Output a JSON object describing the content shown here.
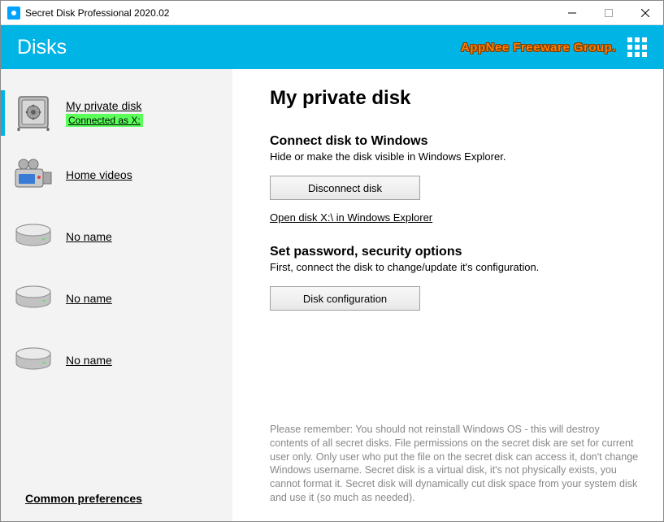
{
  "window": {
    "title": "Secret Disk Professional 2020.02"
  },
  "header": {
    "title": "Disks",
    "brand": "AppNee Freeware Group."
  },
  "sidebar": {
    "items": [
      {
        "label": "My private disk",
        "status": "Connected as X:"
      },
      {
        "label": "Home videos"
      },
      {
        "label": "No name"
      },
      {
        "label": "No name"
      },
      {
        "label": "No name"
      }
    ],
    "common_prefs": "Common preferences"
  },
  "main": {
    "title": "My private disk",
    "connect": {
      "heading": "Connect disk to Windows",
      "desc": "Hide or make the disk visible in Windows Explorer.",
      "button": "Disconnect disk",
      "link": "Open disk X:\\ in Windows Explorer"
    },
    "security": {
      "heading": "Set password, security options",
      "desc": "First, connect the disk to change/update it's configuration.",
      "button": "Disk configuration"
    },
    "note": "Please remember: You should not reinstall Windows OS - this will destroy contents of all secret disks. File permissions on the secret disk are set for current user only. Only user who put the file on the secret disk can access it, don't change Windows username. Secret disk is a virtual disk, it's not physically exists, you cannot format it. Secret disk will dynamically cut disk space from your system disk and use it (so much as needed)."
  }
}
